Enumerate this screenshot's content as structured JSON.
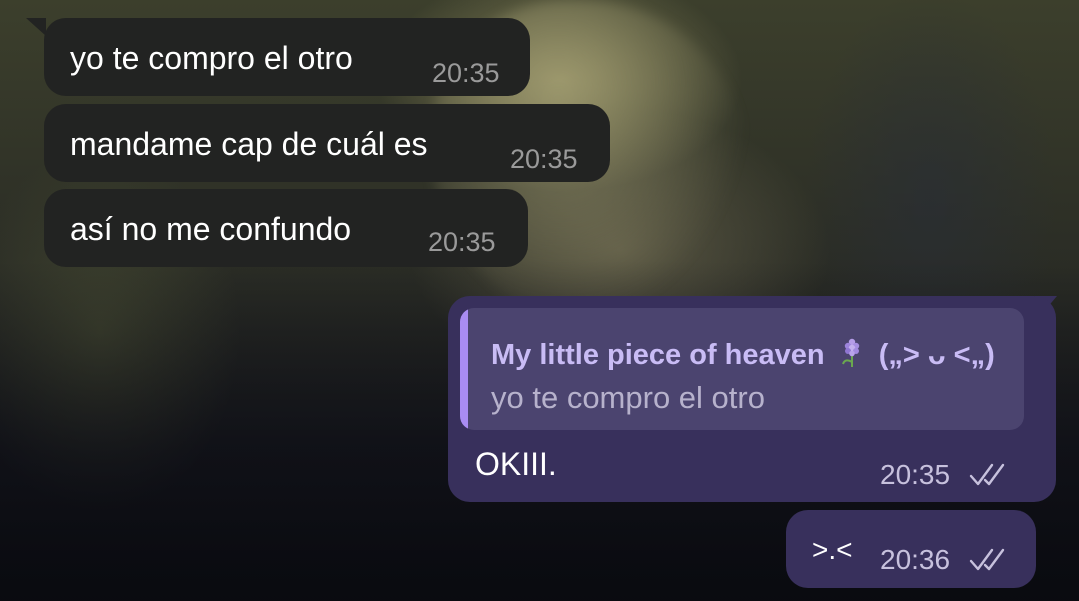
{
  "messages_in": [
    {
      "text": "yo te compro el otro",
      "time": "20:35"
    },
    {
      "text": "mandame cap de cuál es",
      "time": "20:35"
    },
    {
      "text": "así no me confundo",
      "time": "20:35"
    }
  ],
  "message_out_1": {
    "reply": {
      "name": "My little piece of heaven",
      "name_suffix": "(„> ᴗ <„)",
      "emoji_icon": "hyacinth-emoji",
      "text": "yo te compro el otro"
    },
    "text": "OKIII.",
    "time": "20:35",
    "status_icon": "double-check-read-icon"
  },
  "message_out_2": {
    "text": ">.<",
    "time": "20:36",
    "status_icon": "double-check-read-icon"
  },
  "colors": {
    "incoming_bubble": "#222322",
    "outgoing_bubble": "#38305c",
    "reply_accent": "#a98cf2",
    "reply_name": "#c9bcf5"
  }
}
